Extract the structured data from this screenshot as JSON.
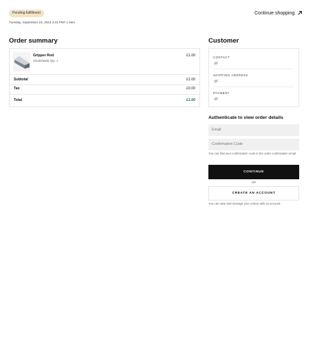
{
  "status_badge": "Pending fulfillment",
  "order_meta": "Tuesday, September 19, 2023 4:31 PM? 1 item",
  "continue_shopping": "Continue shopping",
  "order_summary": {
    "title": "Order summary",
    "item": {
      "name": "Gripper Rod",
      "meta": "SG2825605 Qty: 1",
      "price": "£1.00"
    },
    "subtotal_label": "Subtotal",
    "subtotal_value": "£1.00",
    "tax_label": "Tax",
    "tax_value": "£0.00",
    "total_label": "Total",
    "total_value": "£1.00"
  },
  "customer": {
    "title": "Customer",
    "contact_label": "CONTACT",
    "shipping_label": "SHIPPING ADDRESS",
    "payment_label": "PAYMENT"
  },
  "auth": {
    "title": "Authenticate to view order details",
    "email_placeholder": "Email",
    "code_placeholder": "Confirmation Code",
    "code_hint": "You can find your confirmation code in the order confirmation email.",
    "continue_label": "CONTINUE",
    "or_label": "OR",
    "create_account_label": "CREATE AN ACCOUNT",
    "account_hint": "You can view and manage your orders with an account."
  },
  "colors": {
    "badge_bg": "#f3e3c8",
    "total_green": "#2e6b3a",
    "primary_button": "#111111"
  }
}
